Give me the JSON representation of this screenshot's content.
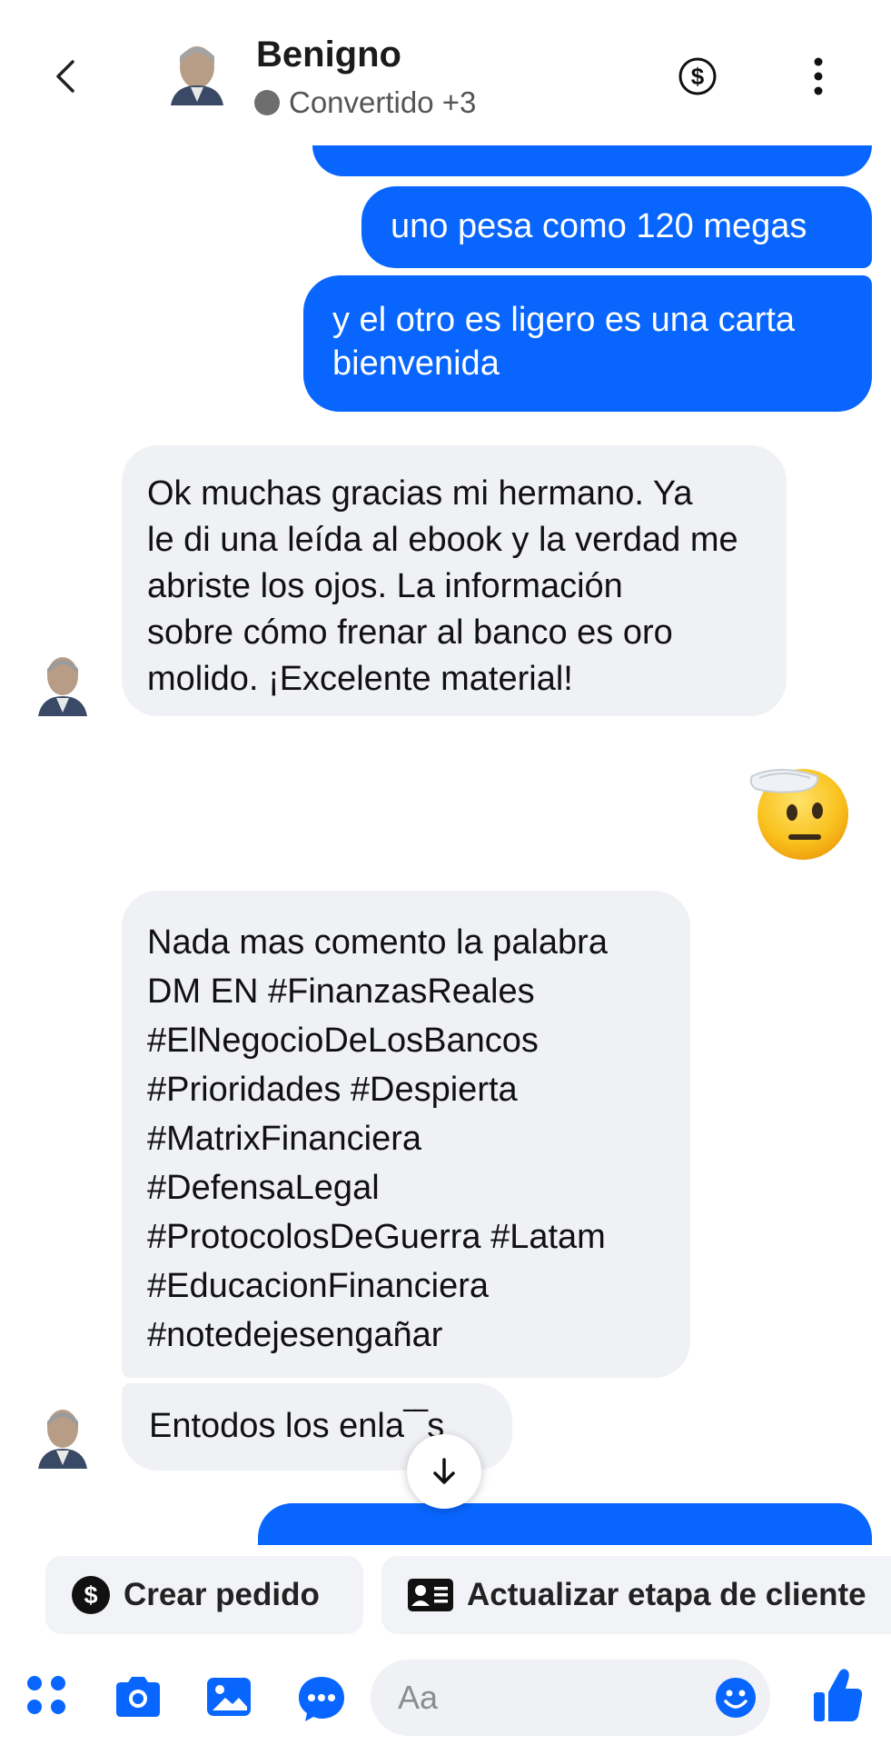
{
  "header": {
    "name": "Benigno",
    "status": "Convertido +3"
  },
  "messages": [
    {
      "id": "m0",
      "direction": "outgoing",
      "text": ""
    },
    {
      "id": "m1",
      "direction": "outgoing",
      "text": "uno pesa como 120 megas"
    },
    {
      "id": "m2",
      "direction": "outgoing",
      "lines": [
        "y el otro es ligero es una carta",
        "bienvenida"
      ]
    },
    {
      "id": "m3",
      "direction": "incoming",
      "lines": [
        "Ok muchas gracias mi hermano. Ya",
        "le di una leída al ebook y la verdad me",
        "abriste los ojos. La información",
        "sobre cómo frenar al banco es oro",
        "molido. ¡Excelente material!"
      ]
    },
    {
      "id": "m4",
      "direction": "outgoing",
      "type": "emoji",
      "emoji": "saluting-face"
    },
    {
      "id": "m5",
      "direction": "incoming",
      "lines": [
        "Nada mas comento la palabra",
        "DM EN #FinanzasReales",
        "#ElNegocioDeLosBancos",
        "#Prioridades #Despierta",
        "#MatrixFinanciera",
        "#DefensaLegal",
        "#ProtocolosDeGuerra #Latam",
        "#EducacionFinanciera",
        "#notedejesengañar"
      ]
    },
    {
      "id": "m6",
      "direction": "incoming",
      "text": "Entodos los enla"
    },
    {
      "id": "m7",
      "direction": "outgoing",
      "text": ""
    }
  ],
  "quick_actions": [
    {
      "label": "Crear pedido",
      "icon": "dollar-circle-icon"
    },
    {
      "label": "Actualizar etapa de cliente",
      "icon": "contact-card-icon"
    }
  ],
  "composer": {
    "placeholder": "Aa",
    "icons": [
      "apps-icon",
      "camera-icon",
      "gallery-icon",
      "chat-more-icon",
      "emoji-icon",
      "like-icon"
    ]
  },
  "colors": {
    "outgoing_bubble": "#0865fe",
    "incoming_bubble": "#f0f1f5",
    "accent": "#0866ff",
    "status_dot": "#6e6e6e"
  }
}
